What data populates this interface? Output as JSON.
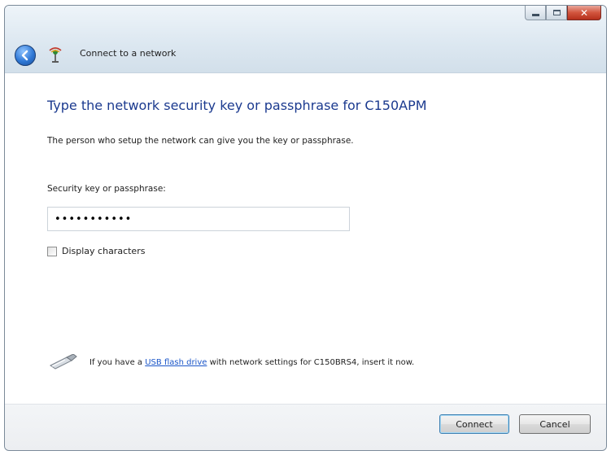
{
  "window": {
    "title": "Connect to a network",
    "controls": {
      "minimize": "minimize",
      "maximize": "maximize",
      "close": "close"
    }
  },
  "content": {
    "heading": "Type the network security key or passphrase for C150APM",
    "description": "The person who setup the network can give you the key or passphrase.",
    "key_label": "Security key or passphrase:",
    "key_value": "•••••••••••",
    "display_characters_label": "Display characters",
    "display_characters_checked": false,
    "usb": {
      "text_before": "If you have a ",
      "link_text": "USB flash drive",
      "text_after": " with network settings for C150BRS4, insert it now."
    }
  },
  "footer": {
    "connect_label": "Connect",
    "cancel_label": "Cancel"
  },
  "colors": {
    "heading": "#1b3a8f",
    "link": "#1b56c8",
    "close_button": "#c8452f"
  }
}
